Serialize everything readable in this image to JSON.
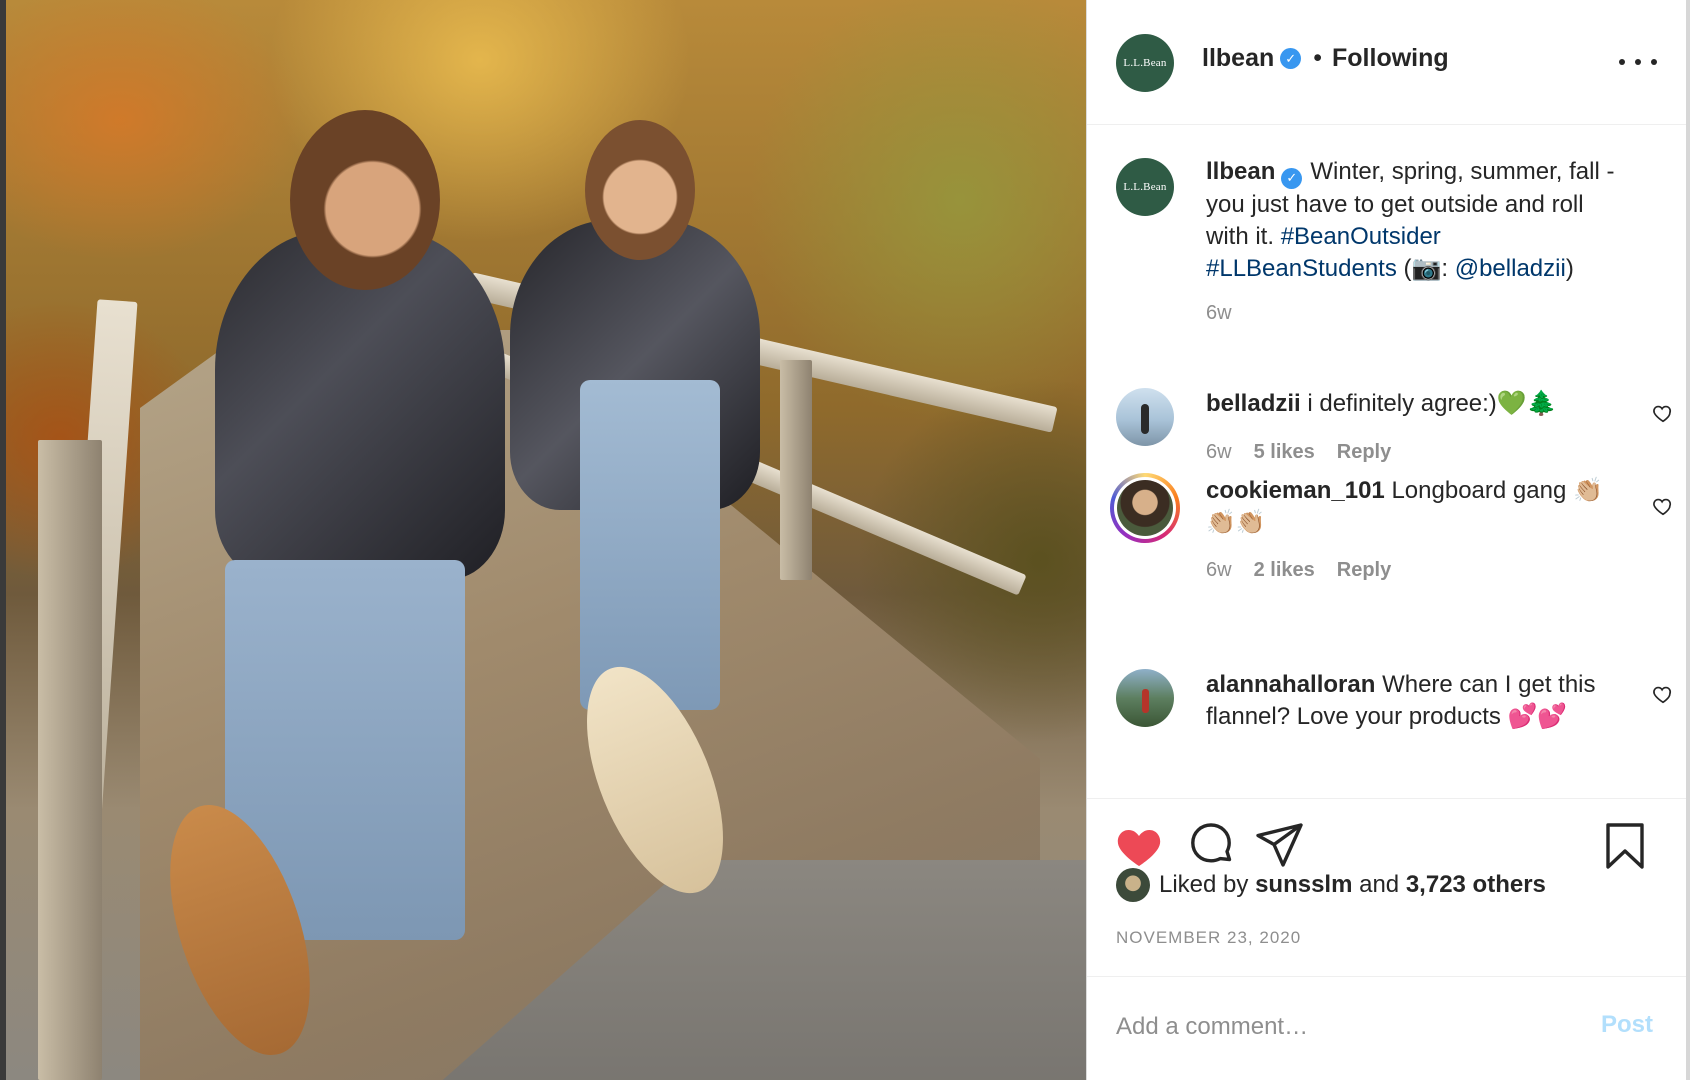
{
  "post": {
    "author": "llbean",
    "author_avatar_text": "L.L.Bean",
    "follow_separator": "•",
    "follow_status": "Following",
    "verified_icon": "verified-badge-icon",
    "more_icon": "more-options-icon"
  },
  "caption": {
    "username": "llbean",
    "text": "Winter, spring, summer, fall - you just have to get outside and roll with it.",
    "hashtag_1": "#BeanOutsider",
    "hashtag_2": "#LLBeanStudents",
    "credit_open": "(📷: ",
    "mention": "@belladzii",
    "credit_close": ")",
    "time": "6w"
  },
  "comments": [
    {
      "username": "belladzii",
      "text": "i definitely agree:)💚🌲",
      "time": "6w",
      "likes": "5 likes",
      "reply": "Reply"
    },
    {
      "username": "cookieman_101",
      "text": "Longboard gang 👏🏼👏🏼👏🏼",
      "time": "6w",
      "likes": "2 likes",
      "reply": "Reply"
    },
    {
      "username": "alannahalloran",
      "text": "Where can I get this flannel? Love your products 💕💕"
    }
  ],
  "likes": {
    "prefix": "Liked by",
    "liker": "sunsslm",
    "joiner": "and",
    "others": "3,723 others"
  },
  "date": "NOVEMBER 23, 2020",
  "add_comment": {
    "placeholder": "Add a comment…",
    "post_label": "Post"
  },
  "colors": {
    "like_red": "#ed4956",
    "verified_blue": "#3897f0",
    "link_blue": "#00376b",
    "post_disabled": "#b2dffc",
    "brand_green": "#2f5b45"
  }
}
